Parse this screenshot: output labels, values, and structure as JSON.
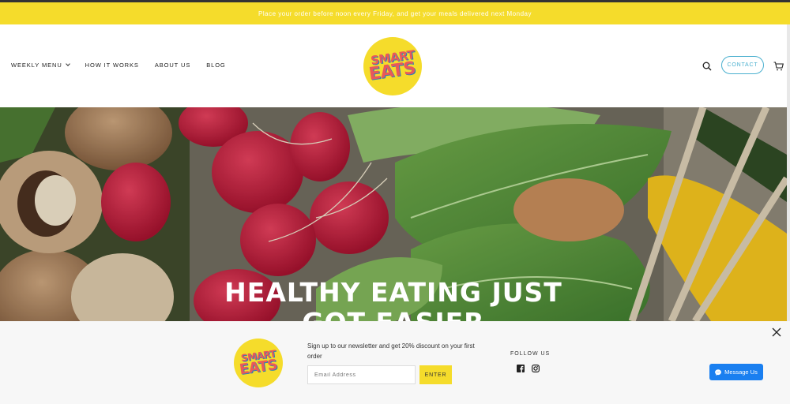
{
  "announcement": "Place your order before noon every Friday, and get your meals delivered next Monday",
  "nav": {
    "items": [
      {
        "label": "WEEKLY MENU"
      },
      {
        "label": "HOW IT WORKS"
      },
      {
        "label": "ABOUT US"
      },
      {
        "label": "BLOG"
      }
    ]
  },
  "logo": {
    "line1": "SMART",
    "line2": "EATS"
  },
  "header": {
    "contact_label": "CONTACT",
    "icons": [
      "search-icon",
      "cart-icon"
    ]
  },
  "hero": {
    "title_line1": "HEALTHY EATING JUST",
    "title_line2": "GOT EASIER"
  },
  "newsletter": {
    "text": "Sign up to our newsletter and get 20% discount on your first order",
    "email_placeholder": "Email Address",
    "email_value": "",
    "submit_label": "ENTER"
  },
  "follow": {
    "label": "FOLLOW US",
    "icons": [
      "facebook-icon",
      "instagram-icon"
    ]
  },
  "messenger": {
    "label": "Message Us"
  },
  "colors": {
    "brand_yellow": "#f5dc2b",
    "accent_blue": "#4ab0cf",
    "logo_red": "#e9595a",
    "messenger_blue": "#1a7ff0"
  }
}
